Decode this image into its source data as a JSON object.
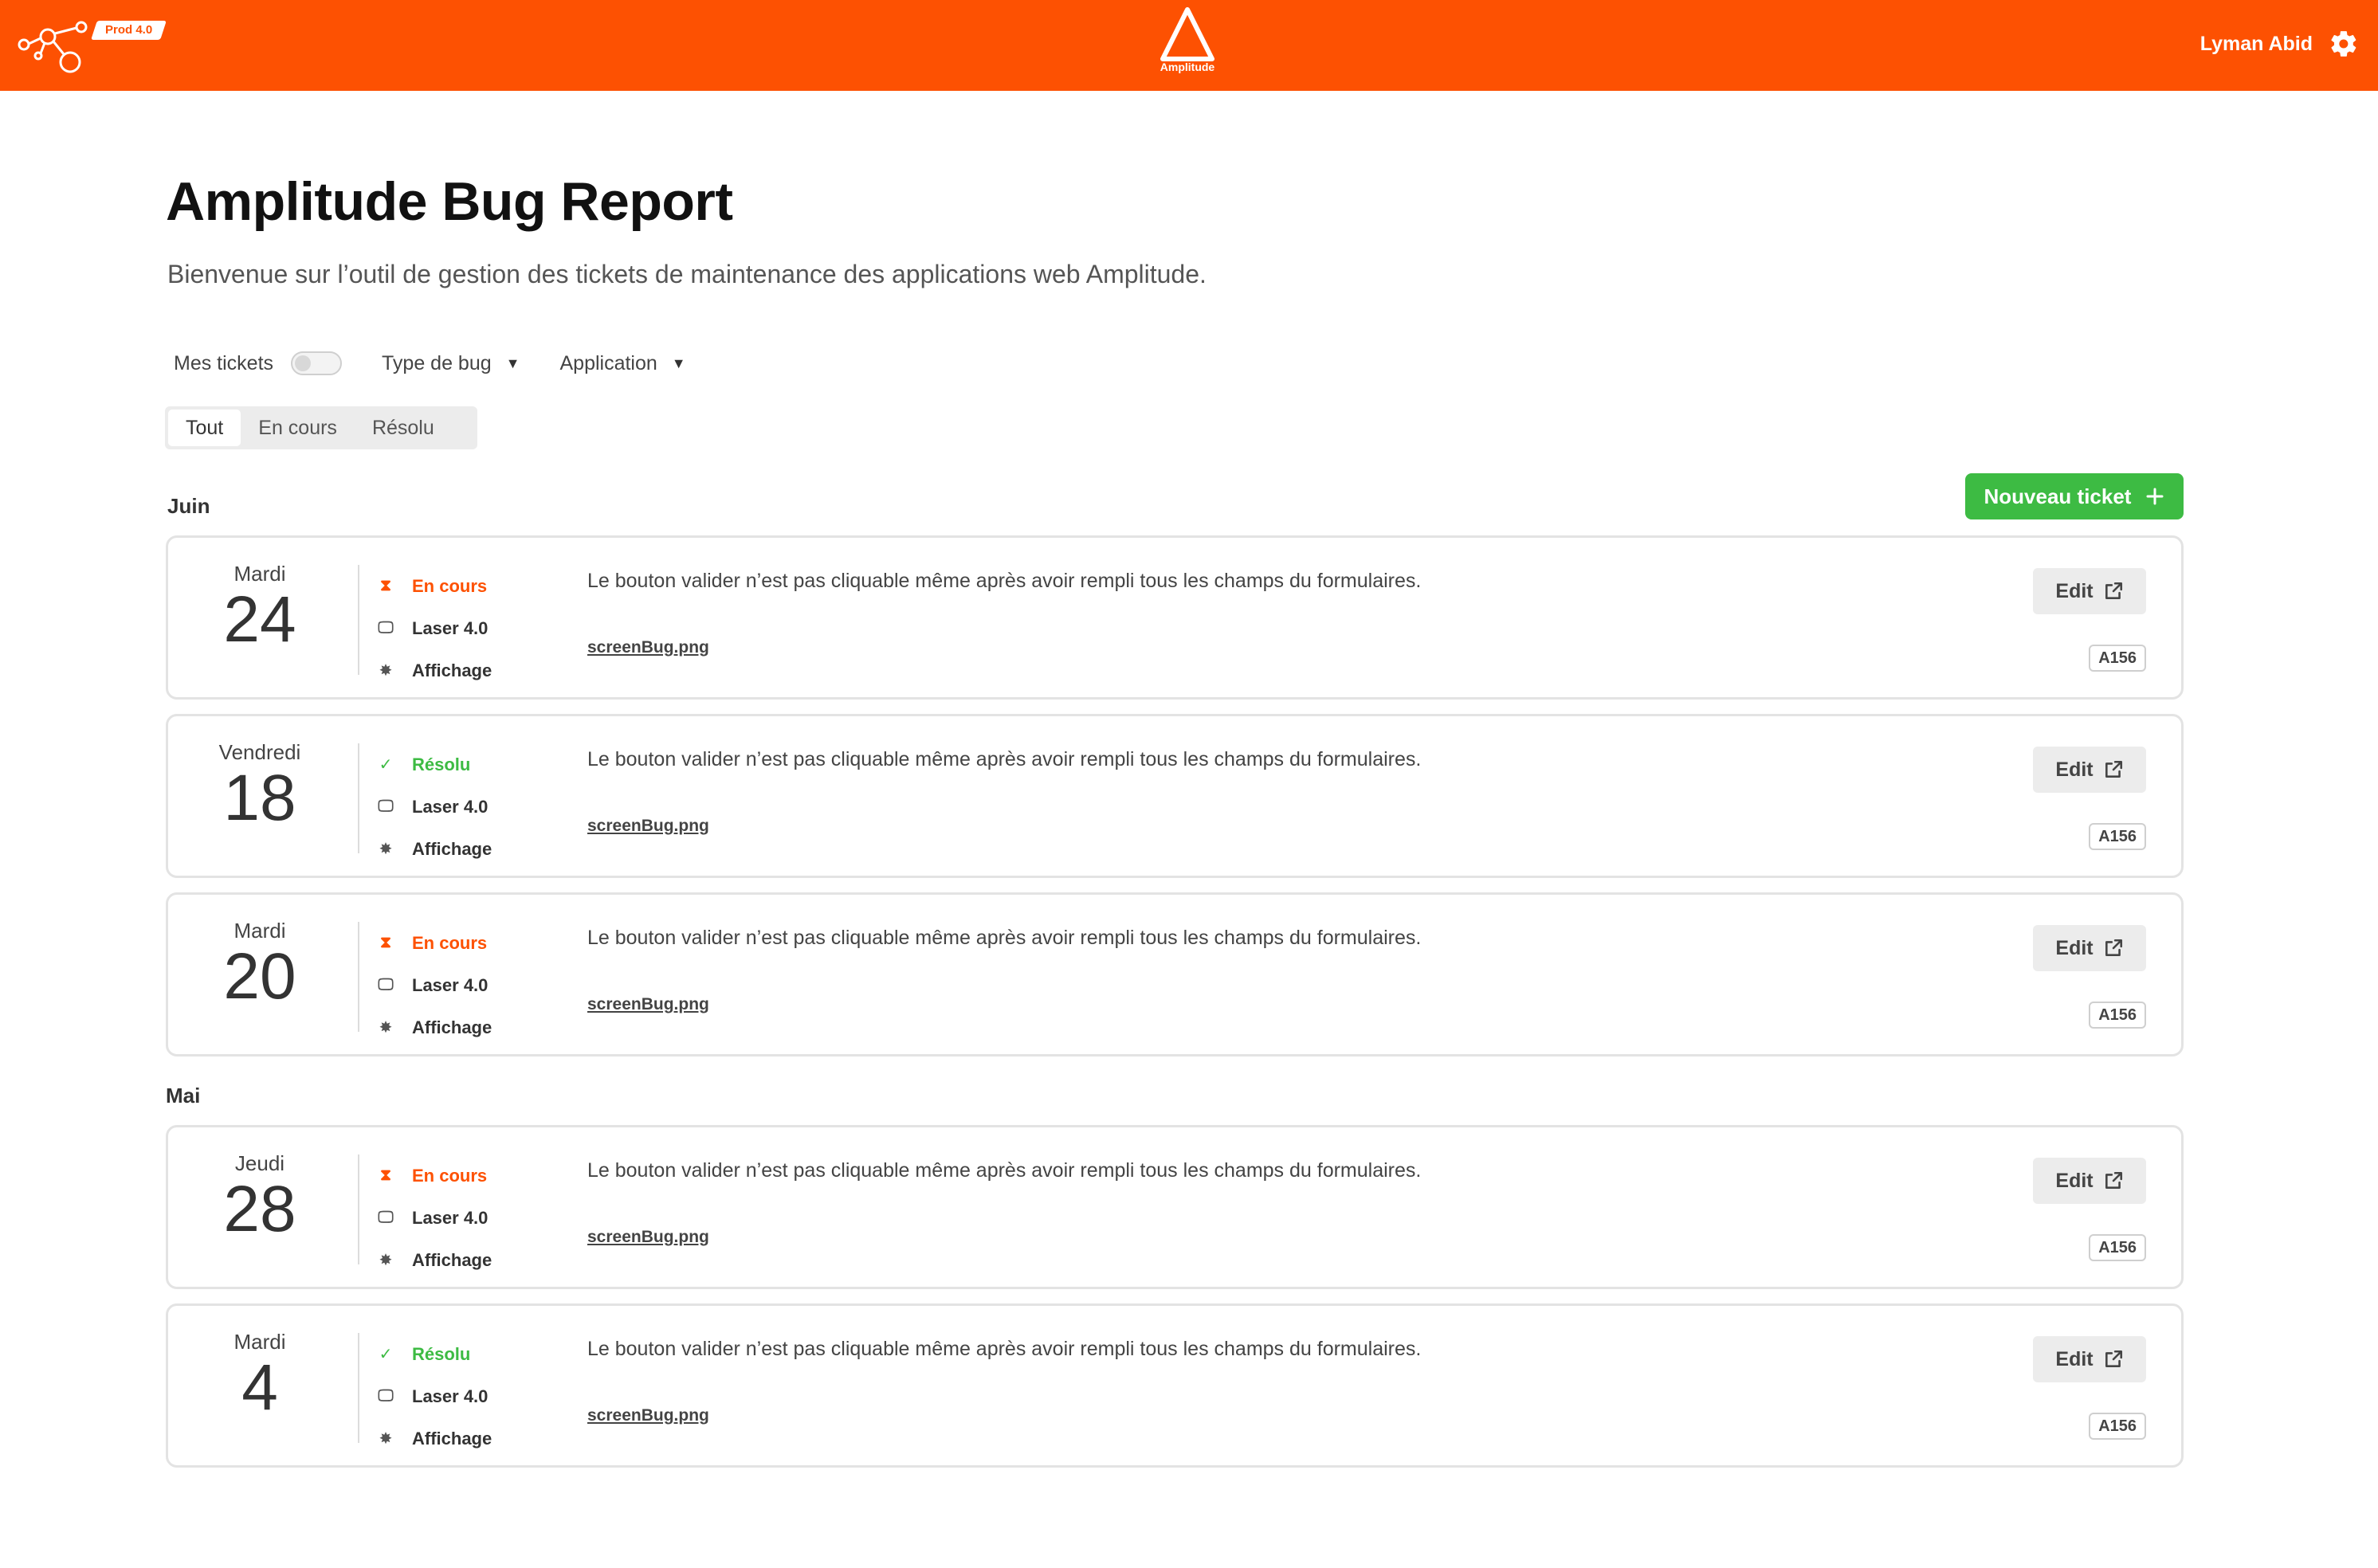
{
  "header": {
    "env_badge": "Prod 4.0",
    "brand_label": "Amplitude",
    "user_name": "Lyman Abid",
    "background": "#FD5102"
  },
  "page": {
    "title": "Amplitude Bug Report",
    "subtitle": "Bienvenue sur l’outil de gestion des tickets de maintenance des applications web Amplitude."
  },
  "filters": {
    "my_tickets_label": "Mes tickets",
    "my_tickets_on": false,
    "bug_type_label": "Type de bug",
    "application_label": "Application",
    "tabs": [
      {
        "label": "Tout",
        "active": true
      },
      {
        "label": "En cours",
        "active": false
      },
      {
        "label": "Résolu",
        "active": false
      }
    ]
  },
  "new_ticket_label": "Nouveau ticket",
  "months": [
    {
      "name": "Juin",
      "tickets": [
        {
          "dayname": "Mardi",
          "day": "24",
          "status": "En cours",
          "status_type": "open",
          "app": "Laser 4.0",
          "category": "Affichage",
          "description": "Le bouton valider n’est pas cliquable même après avoir rempli tous les champs du formulaires.",
          "attachment": "screenBug.png",
          "edit_label": "Edit",
          "ref": "A156"
        },
        {
          "dayname": "Vendredi",
          "day": "18",
          "status": "Résolu",
          "status_type": "done",
          "app": "Laser 4.0",
          "category": "Affichage",
          "description": "Le bouton valider n’est pas cliquable même après avoir rempli tous les champs du formulaires.",
          "attachment": "screenBug.png",
          "edit_label": "Edit",
          "ref": "A156"
        },
        {
          "dayname": "Mardi",
          "day": "20",
          "status": "En cours",
          "status_type": "open",
          "app": "Laser 4.0",
          "category": "Affichage",
          "description": "Le bouton valider n’est pas cliquable même après avoir rempli tous les champs du formulaires.",
          "attachment": "screenBug.png",
          "edit_label": "Edit",
          "ref": "A156"
        }
      ]
    },
    {
      "name": "Mai",
      "tickets": [
        {
          "dayname": "Jeudi",
          "day": "28",
          "status": "En cours",
          "status_type": "open",
          "app": "Laser 4.0",
          "category": "Affichage",
          "description": "Le bouton valider n’est pas cliquable même après avoir rempli tous les champs du formulaires.",
          "attachment": "screenBug.png",
          "edit_label": "Edit",
          "ref": "A156"
        },
        {
          "dayname": "Mardi",
          "day": "4",
          "status": "Résolu",
          "status_type": "done",
          "app": "Laser 4.0",
          "category": "Affichage",
          "description": "Le bouton valider n’est pas cliquable même après avoir rempli tous les champs du formulaires.",
          "attachment": "screenBug.png",
          "edit_label": "Edit",
          "ref": "A156"
        }
      ]
    }
  ],
  "colors": {
    "accent": "#FD5102",
    "success": "#3DBB43"
  }
}
